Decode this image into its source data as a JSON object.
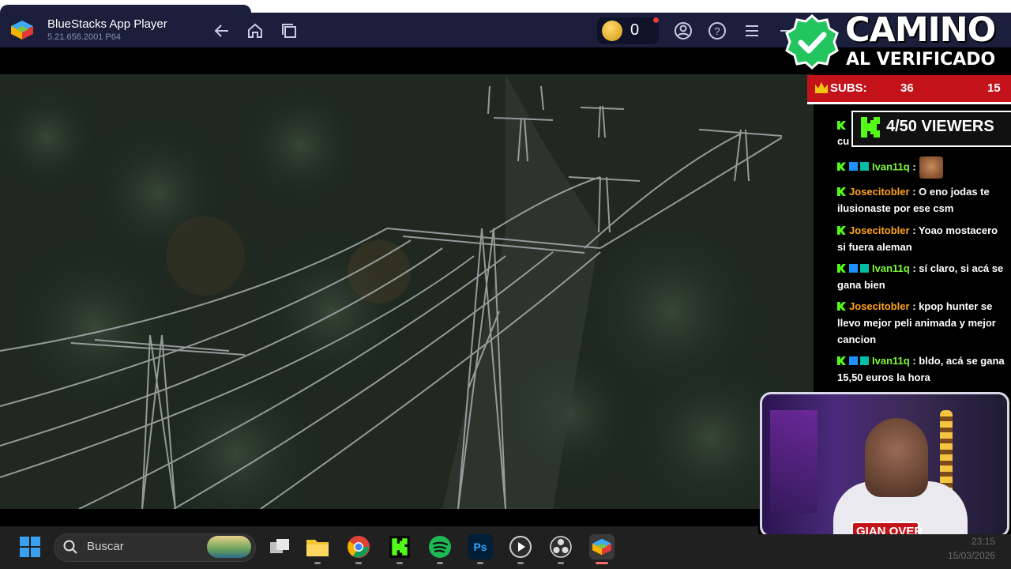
{
  "window": {
    "title": "BlueStacks App Player",
    "version": "5.21.656.2001 P64",
    "coins": "0",
    "icons": [
      "back-icon",
      "home-icon",
      "multi-instance-icon",
      "account-icon",
      "help-icon",
      "menu-icon",
      "minimize-icon"
    ]
  },
  "overlay": {
    "headline": "CAMINO",
    "subheadline": "AL VERIFICADO",
    "subs_label": "SUBS:",
    "subs_count": "36",
    "subs_goal": "15",
    "viewers": "4/50 VIEWERS",
    "accent_color": "#c4121b",
    "kick_color": "#53fc18"
  },
  "chat": {
    "messages": [
      {
        "user": "",
        "text": "cu",
        "badges": [
          "kick"
        ],
        "user_color": "green"
      },
      {
        "user": "Ivan11q",
        "text": "",
        "badges": [
          "kick",
          "mod",
          "sub"
        ],
        "user_color": "green",
        "emote": true
      },
      {
        "user": "Josecitobler",
        "text": "O eno jodas te ilusionaste por ese csm",
        "badges": [
          "kick"
        ],
        "user_color": "orange"
      },
      {
        "user": "Josecitobler",
        "text": "Yoao mostacero si fuera aleman",
        "badges": [
          "kick"
        ],
        "user_color": "orange"
      },
      {
        "user": "Ivan11q",
        "text": "sí claro, si acá se gana bien",
        "badges": [
          "kick",
          "mod",
          "sub"
        ],
        "user_color": "green"
      },
      {
        "user": "Josecitobler",
        "text": "kpop hunter se llevo mejor peli animada y mejor cancion",
        "badges": [
          "kick"
        ],
        "user_color": "orange"
      },
      {
        "user": "Ivan11q",
        "text": "bldo, acá se gana 15,50 euros la hora",
        "badges": [
          "kick",
          "mod",
          "sub"
        ],
        "user_color": "green"
      }
    ]
  },
  "webcam": {
    "nameplate": "GIAN OVER"
  },
  "taskbar": {
    "search_label": "Buscar",
    "apps": [
      "task-view",
      "file-explorer",
      "chrome",
      "kick",
      "spotify",
      "photoshop",
      "media-player",
      "obs",
      "bluestacks"
    ],
    "time": "23:15",
    "date": "15/03/2026"
  }
}
